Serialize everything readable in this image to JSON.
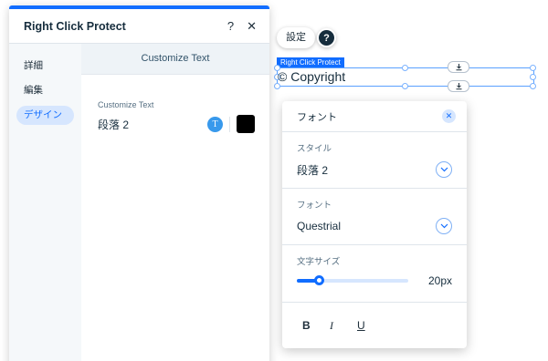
{
  "canvas": {
    "settings_label": "設定",
    "help_label": "?",
    "selection_tag": "Right Click Protect",
    "element_text": "© Copyright"
  },
  "panel": {
    "title": "Right Click Protect",
    "help_label": "?",
    "close_label": "✕",
    "nav": [
      {
        "label": "詳細",
        "active": false
      },
      {
        "label": "編集",
        "active": false
      },
      {
        "label": "デザイン",
        "active": true
      }
    ],
    "content_title": "Customize Text",
    "field_label": "Customize Text",
    "field_value": "段落 2",
    "text_icon_label": "T",
    "swatch_color": "#000000"
  },
  "popover": {
    "title": "フォント",
    "close_label": "✕",
    "style": {
      "label": "スタイル",
      "value": "段落 2"
    },
    "font": {
      "label": "フォント",
      "value": "Questrial"
    },
    "size": {
      "label": "文字サイズ",
      "value": "20",
      "unit": "px",
      "fraction": 0.2
    },
    "format_buttons": [
      "B",
      "I",
      "U"
    ]
  },
  "colors": {
    "accent": "#116dff",
    "text": "#162d3d"
  }
}
